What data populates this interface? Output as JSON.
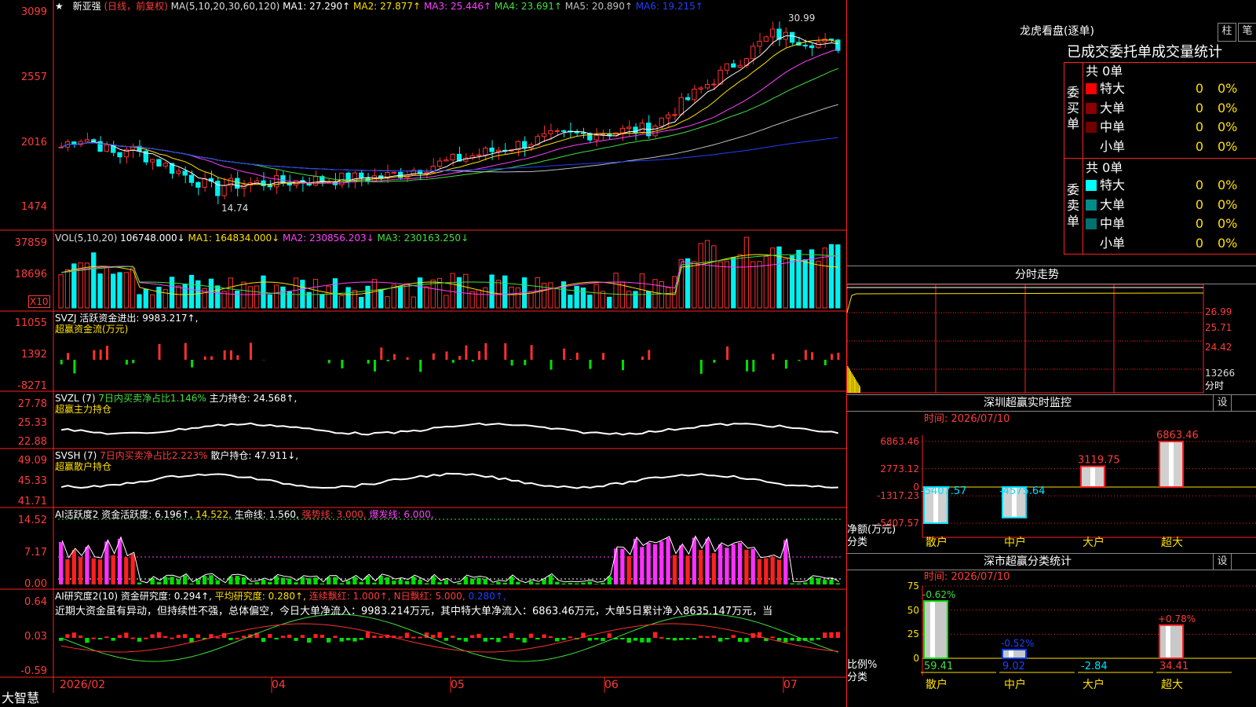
{
  "app": {
    "brand": "大智慧"
  },
  "stock": {
    "name": "新亚强",
    "mode": "(日线，前复权)",
    "star": "★"
  },
  "ma_header": {
    "params": "MA(5,10,20,30,60,120)",
    "items": [
      {
        "label": "MA1: 27.290↑",
        "color": "#ffffff"
      },
      {
        "label": "MA2: 27.877↑",
        "color": "#ffe000"
      },
      {
        "label": "MA3: 25.446↑",
        "color": "#ff40ff"
      },
      {
        "label": "MA4: 23.691↑",
        "color": "#40e040"
      },
      {
        "label": "MA5: 20.890↑",
        "color": "#c0c0c0"
      },
      {
        "label": "MA6: 19.215↑",
        "color": "#2040ff"
      }
    ]
  },
  "price_axis": [
    "3099",
    "2557",
    "2016",
    "1474"
  ],
  "price_annot": {
    "high": "30.99",
    "low": "14.74"
  },
  "vol_header": {
    "params": "VOL(5,10,20)",
    "vol": "106748.000↓",
    "ma1": "MA1: 164834.000↓",
    "ma2": "MA2: 230856.203↓",
    "ma3": "MA3: 230163.250↓"
  },
  "vol_axis": [
    "37859",
    "18696"
  ],
  "vol_unit": "X10",
  "svzj": {
    "title": "SVZJ  活跃资金进出: 9983.217↑,",
    "sub": "超赢资金流(万元)",
    "axis": [
      "11055",
      "1392",
      "-8271"
    ]
  },
  "svzl": {
    "title": "SVZL (7)",
    "ratio": "7日内买卖净占比1.146%",
    "hold": "主力持仓: 24.568↑,",
    "sub": "超赢主力持仓",
    "axis": [
      "27.78",
      "25.33",
      "22.88"
    ]
  },
  "svsh": {
    "title": "SVSH (7)",
    "ratio": "7日内买卖净占比2.223%",
    "hold": "散户持仓: 47.911↓,",
    "sub": "超赢散户持仓",
    "axis": [
      "49.09",
      "45.33",
      "41.71"
    ]
  },
  "ai2": {
    "title": "AI活跃度2",
    "a": "资金活跃度: 6.196↑,",
    "b": "14.522,",
    "c": "生命线: 1.560,",
    "d": "强势线: 3.000,",
    "e": "爆发线: 6.000,",
    "axis": [
      "14.52",
      "7.17",
      "0.00"
    ]
  },
  "ai3": {
    "title": "AI研究度2(10)",
    "a": "资金研究度: 0.294↑,",
    "b": "平均研究度: 0.280↑,",
    "c": "连续飘红: 1.000↑,",
    "d": "N日飘红: 5.000,",
    "e": "0.280↑,",
    "comment": "近期大资金虽有异动，但持续性不强，总体偏空，今日大单净流入：9983.214万元，其中特大单净流入：6863.46万元，大单5日累计净入8635.147万元，当",
    "axis": [
      "0.64",
      "0.03",
      "-0.59"
    ]
  },
  "dates": [
    "2026/02",
    "04",
    "05",
    "06",
    "07"
  ],
  "dragon": {
    "title": "龙虎看盘(逐单)",
    "btn1": "柱",
    "btn2": "笔",
    "tabs": "已成交委托单成交量统计",
    "buy_label": "委买单",
    "sell_label": "委卖单",
    "buy_total": "共 0单",
    "sell_total": "共 0单",
    "buy_rows": [
      {
        "label": "特大",
        "v": "0",
        "p": "0%",
        "color": "#ff0000"
      },
      {
        "label": "大单",
        "v": "0",
        "p": "0%",
        "color": "#8b0000"
      },
      {
        "label": "中单",
        "v": "0",
        "p": "0%",
        "color": "#700000"
      },
      {
        "label": "小单",
        "v": "0",
        "p": "0%",
        "color": ""
      }
    ],
    "sell_rows": [
      {
        "label": "特大",
        "v": "0",
        "p": "0%",
        "color": "#00ffff"
      },
      {
        "label": "大单",
        "v": "0",
        "p": "0%",
        "color": "#008b8b"
      },
      {
        "label": "中单",
        "v": "0",
        "p": "0%",
        "color": "#007070"
      },
      {
        "label": "小单",
        "v": "0",
        "p": "0%",
        "color": ""
      }
    ]
  },
  "intraday": {
    "title": "分时走势",
    "axis": [
      "26.99",
      "25.71",
      "24.42"
    ],
    "vol": "13266",
    "unit": "分时"
  },
  "monitor": {
    "title": "深圳超赢实时监控",
    "btn": "设",
    "time": "时间: 2026/07/10",
    "axis": [
      "6863.46",
      "2773.12",
      "0",
      "-1317.23",
      "-5407.57"
    ],
    "ylabel": "净额(万元)",
    "xlabel": "分类",
    "categories": [
      "散户",
      "中户",
      "大户",
      "超大"
    ],
    "values": [
      -5407.57,
      -4575.64,
      3119.75,
      6863.46
    ],
    "labels": [
      "-5407.57",
      "-4575.64",
      "3119.75",
      "6863.46"
    ]
  },
  "classify": {
    "title": "深市超赢分类统计",
    "btn": "设",
    "time": "时间: 2026/07/10",
    "axis": [
      "75",
      "50",
      "25",
      "0"
    ],
    "ylabel": "比例%",
    "xlabel": "分类",
    "categories": [
      "散户",
      "中户",
      "大户",
      "超大"
    ],
    "values": [
      59.41,
      9.02,
      -2.84,
      34.41
    ],
    "labels": [
      "59.41",
      "9.02",
      "-2.84",
      "34.41"
    ],
    "changes": [
      "-0.62%",
      "-0.52%",
      "",
      "+0.78%"
    ]
  },
  "chart_data": {
    "type": "bar",
    "title": "深圳超赢实时监控",
    "categories": [
      "散户",
      "中户",
      "大户",
      "超大"
    ],
    "values": [
      -5407.57,
      -4575.64,
      3119.75,
      6863.46
    ],
    "ylabel": "净额(万元)",
    "xlabel": "分类",
    "ylim": [
      -5407.57,
      6863.46
    ]
  }
}
